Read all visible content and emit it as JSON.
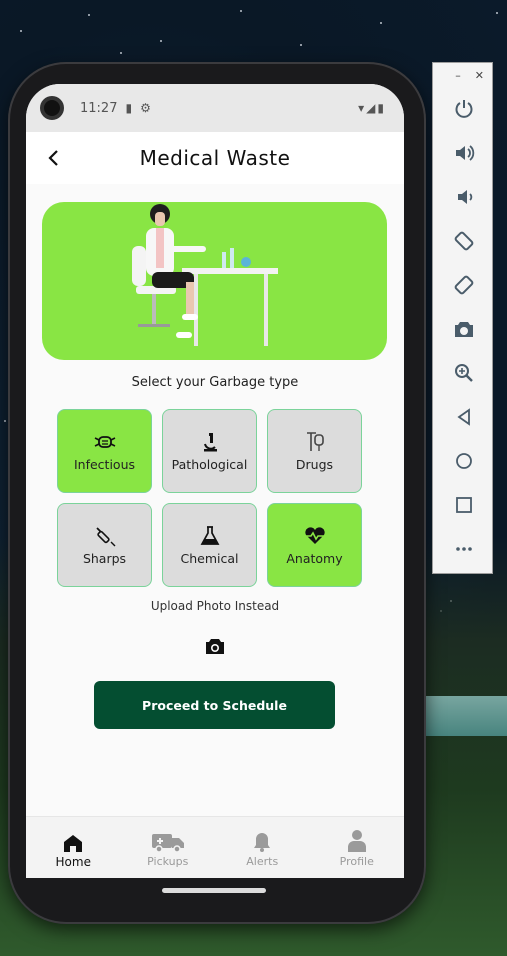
{
  "status_bar": {
    "time": "11:27"
  },
  "app_bar": {
    "title": "Medical Waste"
  },
  "section_label": "Select your Garbage type",
  "garbage_types": [
    {
      "label": "Infectious",
      "icon": "mask-icon",
      "selected": true
    },
    {
      "label": "Pathological",
      "icon": "microscope-icon",
      "selected": false
    },
    {
      "label": "Drugs",
      "icon": "iv-drip-icon",
      "selected": false
    },
    {
      "label": "Sharps",
      "icon": "syringe-icon",
      "selected": false
    },
    {
      "label": "Chemical",
      "icon": "flask-icon",
      "selected": false
    },
    {
      "label": "Anatomy",
      "icon": "heart-pulse-icon",
      "selected": true
    }
  ],
  "upload": {
    "label": "Upload Photo Instead",
    "icon": "camera-icon"
  },
  "proceed_button": {
    "label": "Proceed to Schedule"
  },
  "bottom_nav": [
    {
      "label": "Home",
      "icon": "home-icon",
      "active": true
    },
    {
      "label": "Pickups",
      "icon": "truck-icon",
      "active": false
    },
    {
      "label": "Alerts",
      "icon": "bell-icon",
      "active": false
    },
    {
      "label": "Profile",
      "icon": "person-icon",
      "active": false
    }
  ],
  "emulator_toolbar": {
    "buttons": [
      "power-icon",
      "volume-up-icon",
      "volume-down-icon",
      "rotate-left-icon",
      "rotate-right-icon",
      "screenshot-icon",
      "zoom-icon",
      "back-icon",
      "home-circle-icon",
      "overview-icon",
      "more-icon"
    ]
  },
  "colors": {
    "selected_tile": "#89e544",
    "unselected_tile": "#dcdcdc",
    "tile_border": "#7bd39a",
    "proceed_button": "#044e31",
    "banner": "#89e544"
  }
}
